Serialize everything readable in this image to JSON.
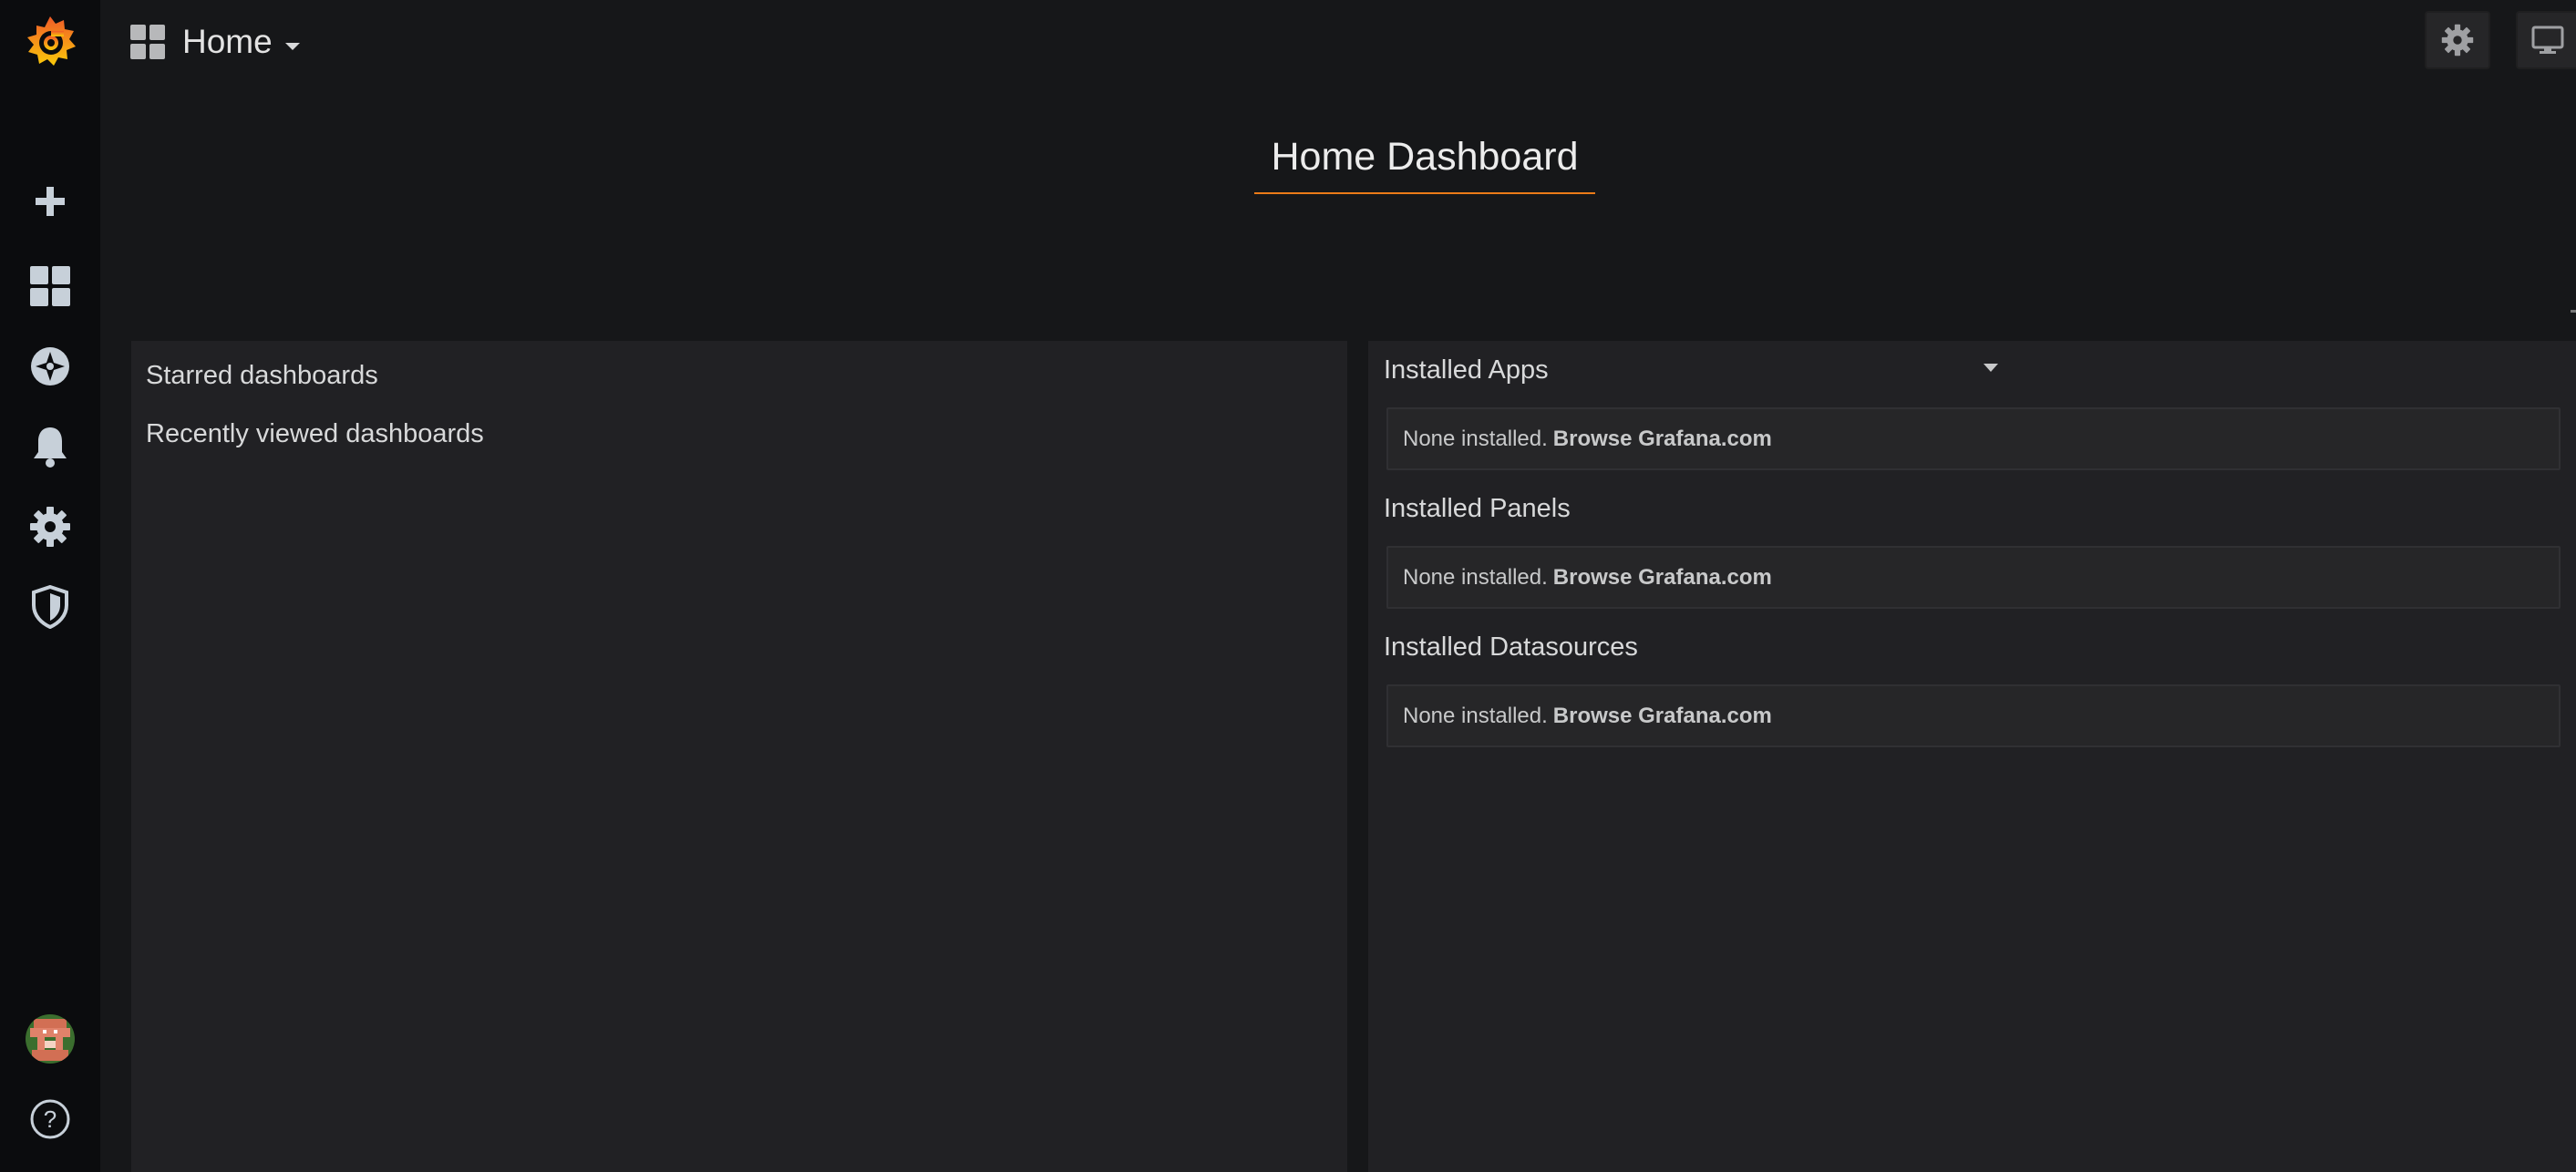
{
  "sidebar": {
    "items": [
      {
        "icon": "grafana-logo-icon"
      },
      {
        "icon": "plus-icon"
      },
      {
        "icon": "dashboards-icon"
      },
      {
        "icon": "explore-compass-icon"
      },
      {
        "icon": "bell-icon"
      },
      {
        "icon": "gear-icon"
      },
      {
        "icon": "shield-icon"
      },
      {
        "icon": "user-avatar"
      },
      {
        "icon": "help-icon"
      }
    ]
  },
  "header": {
    "home_label": "Home",
    "settings_icon": "gear-icon",
    "tv_icon": "monitor-icon"
  },
  "dashboard": {
    "title": "Home Dashboard"
  },
  "left_panel": {
    "starred": "Starred dashboards",
    "recent": "Recently viewed dashboards"
  },
  "right_panel": {
    "sections": [
      {
        "title": "Installed Apps",
        "empty_text": "None installed.",
        "link": "Browse Grafana.com"
      },
      {
        "title": "Installed Panels",
        "empty_text": "None installed.",
        "link": "Browse Grafana.com"
      },
      {
        "title": "Installed Datasources",
        "empty_text": "None installed.",
        "link": "Browse Grafana.com"
      }
    ]
  },
  "colors": {
    "accent": "#eb7b18",
    "sidebar_bg": "#0b0c0e",
    "page_bg": "#161719",
    "panel_bg": "#212124"
  }
}
